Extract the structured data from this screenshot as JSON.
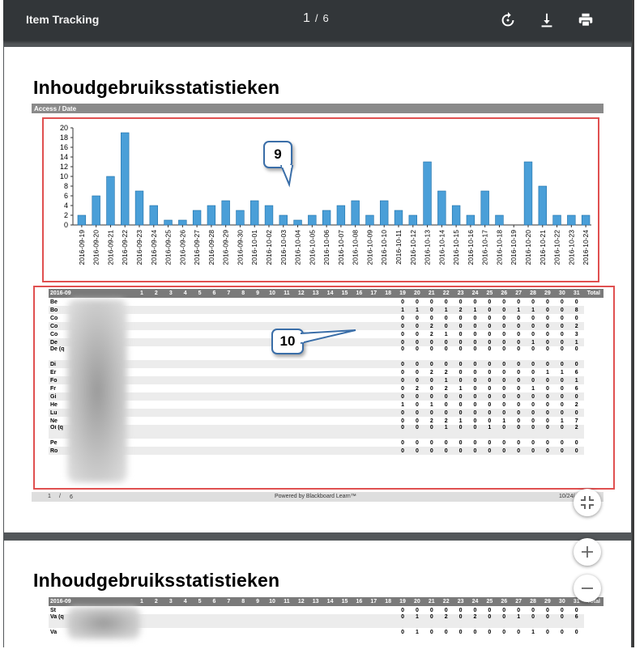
{
  "toolbar": {
    "title": "Item Tracking",
    "current_page": "1",
    "separator": "/",
    "total_pages": "6",
    "icons": [
      "rotate-icon",
      "download-icon",
      "print-icon"
    ]
  },
  "page1": {
    "heading": "Inhoudgebruiksstatistieken",
    "chart_bar_label": "Access / Date",
    "callout_chart": "9",
    "callout_table": "10",
    "footer_page": "1",
    "footer_sep": "/",
    "footer_total": "6",
    "footer_center": "Powered by Blackboard Learn™",
    "footer_right": "10/24/"
  },
  "page2": {
    "heading": "Inhoudgebruiksstatistieken"
  },
  "chart_data": {
    "type": "bar",
    "categories": [
      "2016-09-19",
      "2016-09-20",
      "2016-09-21",
      "2016-09-22",
      "2016-09-23",
      "2016-09-24",
      "2016-09-25",
      "2016-09-26",
      "2016-09-27",
      "2016-09-28",
      "2016-09-29",
      "2016-09-30",
      "2016-10-01",
      "2016-10-02",
      "2016-10-03",
      "2016-10-04",
      "2016-10-05",
      "2016-10-06",
      "2016-10-07",
      "2016-10-08",
      "2016-10-09",
      "2016-10-10",
      "2016-10-11",
      "2016-10-12",
      "2016-10-13",
      "2016-10-14",
      "2016-10-15",
      "2016-10-16",
      "2016-10-17",
      "2016-10-18",
      "2016-10-19",
      "2016-10-20",
      "2016-10-21",
      "2016-10-22",
      "2016-10-23",
      "2016-10-24"
    ],
    "values": [
      2,
      6,
      10,
      19,
      7,
      4,
      1,
      1,
      3,
      4,
      5,
      3,
      5,
      4,
      2,
      1,
      2,
      3,
      4,
      5,
      2,
      5,
      3,
      2,
      13,
      7,
      4,
      2,
      7,
      2,
      0,
      13,
      8,
      2,
      2,
      2
    ],
    "yticks": [
      "0",
      "2",
      "4",
      "6",
      "8",
      "10",
      "12",
      "14",
      "16",
      "18",
      "20"
    ],
    "ylim": [
      0,
      20
    ],
    "bar_color": "#4a9fd8"
  },
  "table": {
    "month": "2016-09",
    "days": [
      "1",
      "2",
      "3",
      "4",
      "5",
      "6",
      "7",
      "8",
      "9",
      "10",
      "11",
      "12",
      "13",
      "14",
      "15",
      "16",
      "17",
      "18",
      "19",
      "20",
      "21",
      "22",
      "23",
      "24",
      "25",
      "26",
      "27",
      "28",
      "29",
      "30",
      "31"
    ],
    "total_label": "Total",
    "rows": [
      {
        "name": "Be",
        "vals": [
          "0",
          "0",
          "0",
          "0",
          "0",
          "0",
          "0",
          "0",
          "0",
          "0",
          "0",
          "0"
        ],
        "total": "0"
      },
      {
        "name": "Bo",
        "vals": [
          "1",
          "1",
          "0",
          "1",
          "2",
          "1",
          "0",
          "0",
          "1",
          "1",
          "0",
          "0"
        ],
        "total": "8"
      },
      {
        "name": "Co",
        "vals": [
          "0",
          "0",
          "0",
          "0",
          "0",
          "0",
          "0",
          "0",
          "0",
          "0",
          "0",
          "0"
        ],
        "total": "0"
      },
      {
        "name": "Co",
        "vals": [
          "0",
          "0",
          "2",
          "0",
          "0",
          "0",
          "0",
          "0",
          "0",
          "0",
          "0",
          "0"
        ],
        "total": "2"
      },
      {
        "name": "Co",
        "vals": [
          "0",
          "0",
          "2",
          "1",
          "0",
          "0",
          "0",
          "0",
          "0",
          "0",
          "0",
          "0"
        ],
        "total": "3"
      },
      {
        "name": "De",
        "vals": [
          "0",
          "0",
          "0",
          "0",
          "0",
          "0",
          "0",
          "0",
          "0",
          "1",
          "0",
          "0"
        ],
        "total": "1"
      },
      {
        "name": "De (q",
        "vals": [
          "0",
          "0",
          "0",
          "0",
          "0",
          "0",
          "0",
          "0",
          "0",
          "0",
          "0",
          "0"
        ],
        "total": "0",
        "tall": true
      },
      {
        "name": "Di",
        "vals": [
          "0",
          "0",
          "0",
          "0",
          "0",
          "0",
          "0",
          "0",
          "0",
          "0",
          "0",
          "0"
        ],
        "total": "0"
      },
      {
        "name": "Er",
        "vals": [
          "0",
          "0",
          "2",
          "2",
          "0",
          "0",
          "0",
          "0",
          "0",
          "0",
          "1",
          "1"
        ],
        "total": "6"
      },
      {
        "name": "Fo",
        "vals": [
          "0",
          "0",
          "0",
          "1",
          "0",
          "0",
          "0",
          "0",
          "0",
          "0",
          "0",
          "0"
        ],
        "total": "1"
      },
      {
        "name": "Fr",
        "vals": [
          "0",
          "2",
          "0",
          "2",
          "1",
          "0",
          "0",
          "0",
          "0",
          "1",
          "0",
          "0"
        ],
        "total": "6"
      },
      {
        "name": "Gi",
        "vals": [
          "0",
          "0",
          "0",
          "0",
          "0",
          "0",
          "0",
          "0",
          "0",
          "0",
          "0",
          "0"
        ],
        "total": "0"
      },
      {
        "name": "He",
        "vals": [
          "1",
          "0",
          "1",
          "0",
          "0",
          "0",
          "0",
          "0",
          "0",
          "0",
          "0",
          "0"
        ],
        "total": "2"
      },
      {
        "name": "Lu",
        "vals": [
          "0",
          "0",
          "0",
          "0",
          "0",
          "0",
          "0",
          "0",
          "0",
          "0",
          "0",
          "0"
        ],
        "total": "0"
      },
      {
        "name": "Ne",
        "vals": [
          "0",
          "0",
          "2",
          "2",
          "1",
          "0",
          "0",
          "1",
          "0",
          "0",
          "0",
          "1"
        ],
        "total": "7"
      },
      {
        "name": "Oi (q",
        "vals": [
          "0",
          "0",
          "0",
          "1",
          "0",
          "0",
          "1",
          "0",
          "0",
          "0",
          "0",
          "0"
        ],
        "total": "2",
        "tall": true
      },
      {
        "name": "Pe",
        "vals": [
          "0",
          "0",
          "0",
          "0",
          "0",
          "0",
          "0",
          "0",
          "0",
          "0",
          "0",
          "0"
        ],
        "total": "0"
      },
      {
        "name": "Ro",
        "vals": [
          "0",
          "0",
          "0",
          "0",
          "0",
          "0",
          "0",
          "0",
          "0",
          "0",
          "0",
          "0"
        ],
        "total": "0"
      }
    ],
    "rows_page2": [
      {
        "name": "St",
        "vals": [
          "0",
          "0",
          "0",
          "0",
          "0",
          "0",
          "0",
          "0",
          "0",
          "0",
          "0",
          "0"
        ],
        "total": "0"
      },
      {
        "name": "Va (q",
        "vals": [
          "0",
          "1",
          "0",
          "2",
          "0",
          "2",
          "0",
          "0",
          "1",
          "0",
          "0",
          "0"
        ],
        "total": "6",
        "tall": true
      },
      {
        "name": "Va",
        "vals": [
          "0",
          "1",
          "0",
          "0",
          "0",
          "0",
          "0",
          "0",
          "0",
          "1",
          "0",
          "0"
        ],
        "total": "0"
      }
    ]
  }
}
